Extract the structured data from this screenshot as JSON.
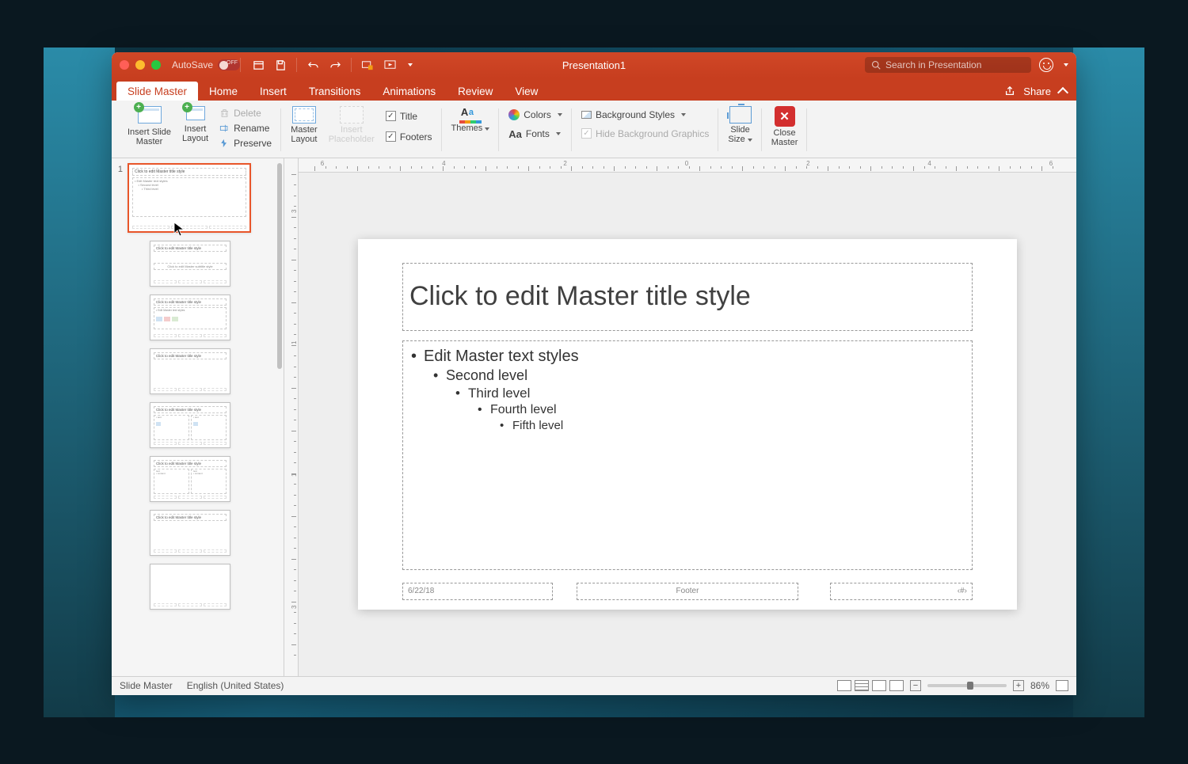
{
  "window": {
    "title": "Presentation1",
    "autosave_label": "AutoSave",
    "autosave_state": "OFF"
  },
  "search": {
    "placeholder": "Search in Presentation"
  },
  "tabs": [
    "Slide Master",
    "Home",
    "Insert",
    "Transitions",
    "Animations",
    "Review",
    "View"
  ],
  "active_tab": "Slide Master",
  "share": {
    "label": "Share"
  },
  "ribbon": {
    "insert_slide_master": "Insert Slide\nMaster",
    "insert_layout": "Insert\nLayout",
    "delete": "Delete",
    "rename": "Rename",
    "preserve": "Preserve",
    "master_layout": "Master\nLayout",
    "insert_placeholder": "Insert\nPlaceholder",
    "title": "Title",
    "footers": "Footers",
    "themes": "Themes",
    "colors": "Colors",
    "fonts": "Fonts",
    "background_styles": "Background Styles",
    "hide_bg": "Hide Background Graphics",
    "slide_size": "Slide\nSize",
    "close_master": "Close\nMaster"
  },
  "slide": {
    "title_placeholder": "Click to edit Master title style",
    "body_levels": [
      "Edit Master text styles",
      "Second level",
      "Third level",
      "Fourth level",
      "Fifth level"
    ],
    "date": "6/22/18",
    "footer": "Footer",
    "slidenum": "‹#›"
  },
  "thumbnails": {
    "master": {
      "num": "1",
      "title": "Click to edit Master title style",
      "body": "• Edit Master text styles\n    • Second level\n        • Third level"
    },
    "layouts": [
      {
        "title": "Click to edit Master title style",
        "subtitle": "Click to edit Master subtitle style"
      },
      {
        "title": "Click to edit Master title style",
        "has_content": true
      },
      {
        "title": "Click to edit Master title style"
      },
      {
        "title": "Click to edit Master title style",
        "two_content": true
      },
      {
        "title": "Click to edit Master title style",
        "comparison": true
      },
      {
        "title": "Click to edit Master title style"
      },
      {
        "title": ""
      }
    ]
  },
  "status": {
    "view": "Slide Master",
    "language": "English (United States)",
    "zoom": "86%"
  },
  "ruler": {
    "h_labels": [
      "6",
      "4",
      "2",
      "0",
      "2",
      "4",
      "6"
    ],
    "v_labels": [
      "3",
      "1",
      "1",
      "3"
    ]
  }
}
